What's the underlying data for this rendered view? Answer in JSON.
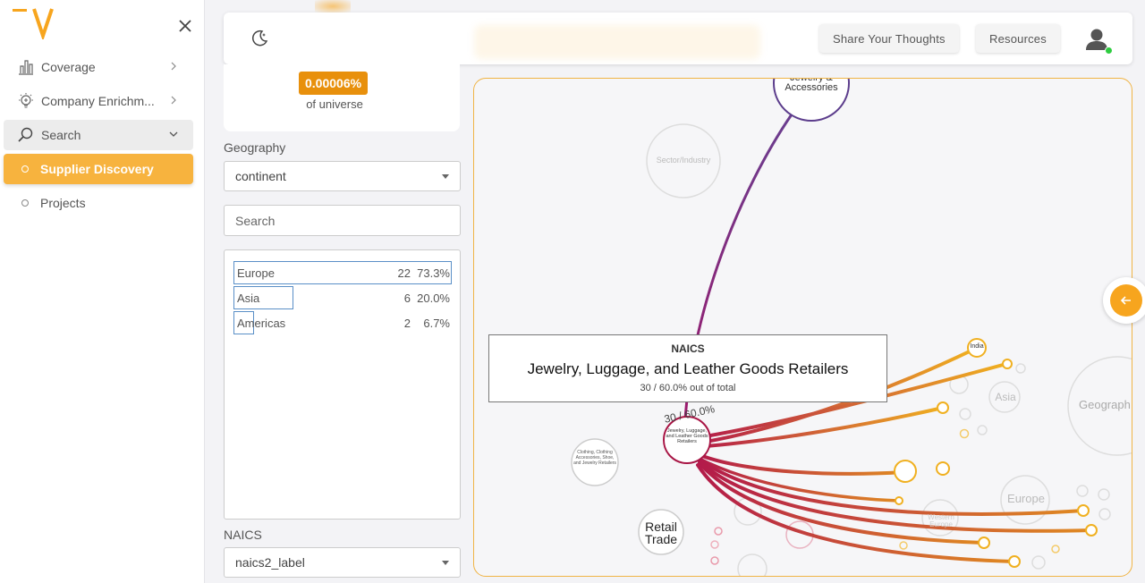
{
  "sidebar": {
    "items": [
      {
        "label": "Coverage",
        "icon": "bar-chart-icon"
      },
      {
        "label": "Company Enrichm...",
        "icon": "lightbulb-icon"
      },
      {
        "label": "Search",
        "icon": "search-icon"
      },
      {
        "label": "Supplier Discovery"
      },
      {
        "label": "Projects"
      }
    ]
  },
  "topbar": {
    "share_label": "Share Your Thoughts",
    "resources_label": "Resources"
  },
  "stat": {
    "value": "0.00006%",
    "caption": "of universe"
  },
  "geography": {
    "label": "Geography",
    "selected": "continent",
    "search_placeholder": "Search",
    "rows": [
      {
        "name": "Europe",
        "count": "22",
        "percent": "73.3%",
        "fraction": 0.733
      },
      {
        "name": "Asia",
        "count": "6",
        "percent": "20.0%",
        "fraction": 0.2
      },
      {
        "name": "Americas",
        "count": "2",
        "percent": "6.7%",
        "fraction": 0.067
      }
    ]
  },
  "naics": {
    "label": "NAICS",
    "selected": "naics2_label"
  },
  "graph": {
    "tooltip": {
      "category": "NAICS",
      "title": "Jewelry, Luggage, and Leather Goods Retailers",
      "subtitle": "30 / 60.0% out of total"
    },
    "nodes": {
      "top": "Jewelry & Accessories",
      "sector": "Sector/Industry",
      "center": "Jewelry, Luggage, and Leather Goods Retailers",
      "center_arc": "30 / 60.0%",
      "clothing": "Clothing, Clothing Accessories, Shoe, and Jewelry Retailers",
      "retail": "Retail Trade",
      "asia": "Asia",
      "geography": "Geograph",
      "europe": "Europe",
      "western_europe": "Western Europe",
      "india": "India"
    },
    "colors": {
      "accent": "#f7a51e",
      "center_node": "#a81545",
      "top_node": "#5c3d8c"
    }
  }
}
